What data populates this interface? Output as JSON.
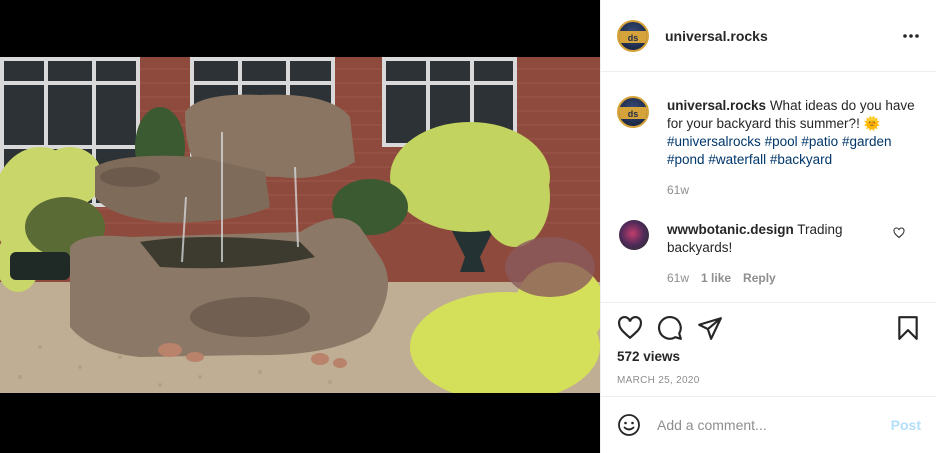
{
  "post": {
    "author": "universal.rocks",
    "media_alt": "Rock waterfall fountain beside a brick house with yellow and green plants",
    "mute_icon": "speaker-muted-icon"
  },
  "caption": {
    "username": "universal.rocks",
    "text": " What ideas do you have for your backyard this summer?! 🌞 ",
    "hashtags": [
      "#universalrocks",
      "#pool",
      "#patio",
      "#garden",
      "#pond",
      "#waterfall",
      "#backyard"
    ],
    "time": "61w"
  },
  "comment": {
    "username": "wwwbotanic.design",
    "text": " Trading backyards!",
    "time": "61w",
    "likes": "1 like",
    "reply_label": "Reply"
  },
  "stats": {
    "views": "572 views",
    "date": "MARCH 25, 2020"
  },
  "add_comment": {
    "placeholder": "Add a comment...",
    "post_label": "Post"
  },
  "colors": {
    "hashtag": "#00376b",
    "muted_text": "#8e8e8e",
    "post_button_disabled": "#b2dffc"
  },
  "icons": [
    "more-options-icon",
    "heart-icon",
    "comment-bubble-icon",
    "share-plane-icon",
    "bookmark-icon",
    "emoji-icon",
    "small-heart-icon"
  ]
}
